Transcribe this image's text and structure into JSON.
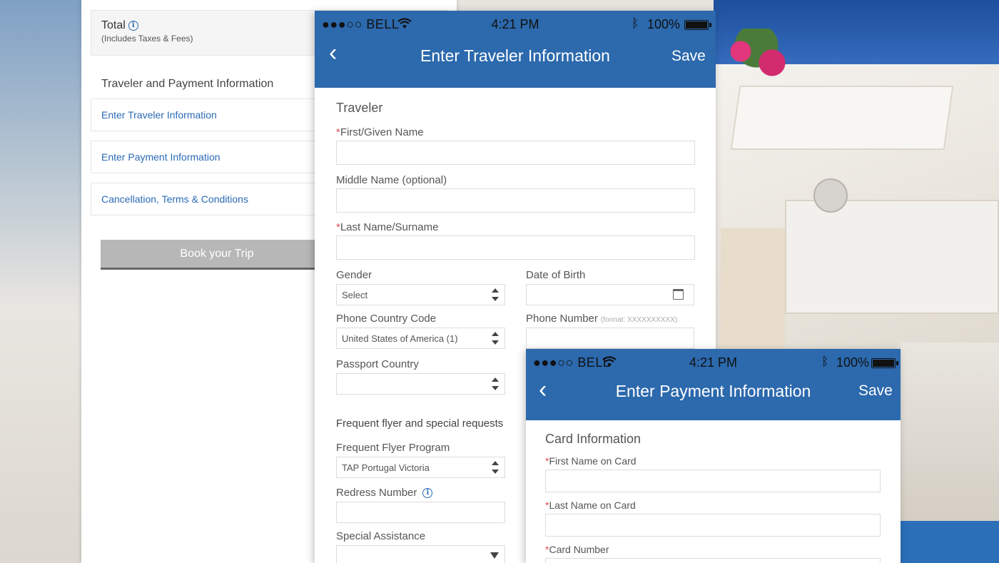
{
  "webpage": {
    "total_label": "Total",
    "total_sub": "(Includes Taxes & Fees)",
    "section_heading": "Traveler and Payment Information",
    "links": [
      "Enter Traveler Information",
      "Enter Payment Information",
      "Cancellation, Terms & Conditions"
    ],
    "book_button": "Book your Trip"
  },
  "traveler_phone": {
    "status": {
      "carrier": "●●●○○ BELL",
      "time": "4:21 PM",
      "battery": "100%"
    },
    "nav": {
      "back": "‹",
      "title": "Enter Traveler Information",
      "save": "Save"
    },
    "section_title": "Traveler",
    "fields": {
      "first_name": "First/Given Name",
      "middle_name": "Middle Name (optional)",
      "last_name": "Last Name/Surname",
      "gender": "Gender",
      "gender_value": "Select",
      "dob": "Date of Birth",
      "phone_country_code": "Phone Country Code",
      "phone_country_code_value": "United States of America (1)",
      "phone_number": "Phone Number",
      "phone_number_hint": "(format: XXXXXXXXXX)",
      "passport_country": "Passport Country",
      "passport_country_value": ""
    },
    "ff_heading": "Frequent flyer and special requests",
    "ff_fields": {
      "program": "Frequent Flyer Program",
      "program_value": "TAP Portugal Victoria",
      "redress": "Redress Number",
      "special_assistance": "Special Assistance"
    }
  },
  "payment_phone": {
    "status": {
      "carrier": "●●●○○ BELL",
      "time": "4:21 PM",
      "battery": "100%"
    },
    "nav": {
      "back": "‹",
      "title": "Enter Payment Information",
      "save": "Save"
    },
    "section_title": "Card Information",
    "fields": {
      "first_name": "First Name on Card",
      "last_name": "Last Name on Card",
      "card_number": "Card Number"
    }
  },
  "required_marker": "*",
  "icons": [
    "info-icon",
    "wifi-icon",
    "bluetooth-icon",
    "battery-icon",
    "back-chevron-icon",
    "calendar-icon",
    "updown-arrows-icon",
    "dropdown-arrow-icon"
  ],
  "colors": {
    "header_blue": "#2c69ad",
    "link_blue": "#2a6ab5",
    "required_red": "#d9534f",
    "button_gray": "#b7b7b7"
  }
}
